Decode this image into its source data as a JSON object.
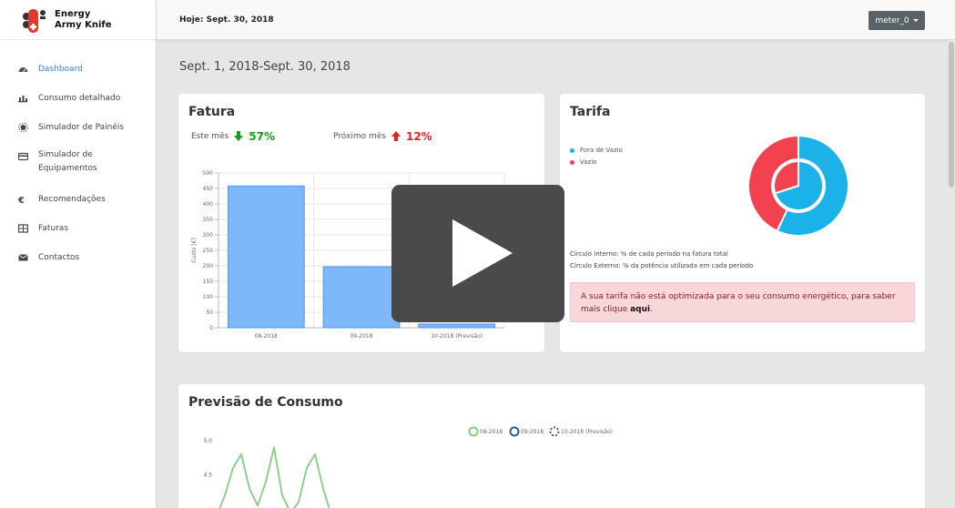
{
  "app": {
    "name_line1": "Energy",
    "name_line2": "Army Knife"
  },
  "header": {
    "today": "Hoje: Sept. 30, 2018",
    "meter_select": "meter_0"
  },
  "sidebar": {
    "items": [
      {
        "label": "Dashboard",
        "icon": "dashboard-icon",
        "active": true
      },
      {
        "label": "Consumo detalhado",
        "icon": "bar-chart-icon"
      },
      {
        "label": "Simulador de Painéis",
        "icon": "sun-icon"
      },
      {
        "label": "Simulador de Equipamentos",
        "icon": "device-icon"
      },
      {
        "label": "Recomendações",
        "icon": "euro-icon"
      },
      {
        "label": "Faturas",
        "icon": "table-icon"
      },
      {
        "label": "Contactos",
        "icon": "envelope-icon"
      }
    ]
  },
  "main": {
    "date_range": "Sept. 1, 2018-Sept. 30, 2018",
    "fatura": {
      "title": "Fatura",
      "this_month_label": "Este mês",
      "this_month_value": "57%",
      "this_month_direction": "down",
      "next_month_label": "Próximo mês",
      "next_month_value": "12%",
      "next_month_direction": "up"
    },
    "tarifa": {
      "title": "Tarifa",
      "legend": [
        {
          "label": "Fora de Vazio",
          "color": "#1ab2e8"
        },
        {
          "label": "Vazio",
          "color": "#f2424f"
        }
      ],
      "note_inner": "Círculo interno: % de cada período na fatura total",
      "note_outer": "Círculo Externo: % da potência utilizada em cada período",
      "alert_text": "A sua tarifa não está optimizada para o seu consumo energético, para saber mais clique ",
      "alert_link": "aqui",
      "alert_end": "."
    },
    "previsao": {
      "title": "Previsão de Consumo"
    }
  },
  "colors": {
    "accent": "#3a7bd5",
    "bar_fill": "#7fb8fa",
    "down": "#1c9a1c",
    "up": "#e8201a",
    "alert_bg": "#f8d7da"
  },
  "video_overlay": {
    "icon": "play-icon"
  },
  "chart_data": [
    {
      "type": "bar",
      "categories": [
        "08-2018",
        "09-2018",
        "10-2018 (Previsão)"
      ],
      "values": [
        458,
        197,
        12
      ],
      "ylabel": "Custo [€]",
      "ylim": [
        0,
        500
      ],
      "yticks": [
        0,
        50,
        100,
        150,
        200,
        250,
        300,
        350,
        400,
        450,
        500
      ],
      "grid": true
    },
    {
      "type": "pie",
      "labels": [
        "Fora de Vazio",
        "Vazio"
      ],
      "inner": [
        70,
        30
      ],
      "outer": [
        57,
        43
      ],
      "colors": [
        "#1ab2e8",
        "#f2424f"
      ]
    },
    {
      "type": "line",
      "series": [
        {
          "name": "08-2018",
          "color": "#7fd07f"
        },
        {
          "name": "09-2018",
          "color": "#1f5fa8"
        },
        {
          "name": "10-2018 (Previsão)",
          "color": "#555555"
        }
      ],
      "yticks": [
        5.0,
        4.5
      ],
      "ylim": [
        3.8,
        5.0
      ],
      "visible_series_08_y": [
        3.9,
        4.2,
        4.6,
        4.8,
        4.3,
        4.05,
        4.4,
        4.9,
        4.2,
        3.95,
        4.1,
        4.6,
        4.8,
        4.3,
        3.9
      ]
    }
  ]
}
